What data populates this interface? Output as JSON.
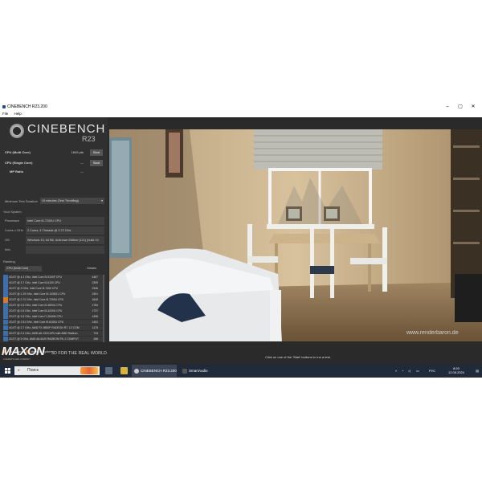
{
  "window": {
    "title": "CINEBENCH R23.200",
    "controls": [
      "–",
      "▢",
      "✕"
    ],
    "menu": [
      "File",
      "Help"
    ]
  },
  "logo": {
    "name": "CINEBENCH",
    "version": "R23"
  },
  "tests": [
    {
      "label": "CPU (Multi Core)",
      "value": "1645 pts",
      "button": "Start"
    },
    {
      "label": "CPU (Single Core)",
      "value": "---",
      "button": "Start"
    },
    {
      "label": "MP Ratio",
      "value": "---"
    }
  ],
  "duration": {
    "label": "Minimum Test Duration",
    "value": "10 minutes (Test Throttling)"
  },
  "system": {
    "title": "Your System",
    "fields": [
      {
        "label": "Processor",
        "value": "Intel Core i5-7200U CPU"
      },
      {
        "label": "Cores x GHz",
        "value": "2 Cores, 4 Threads @ 2.72 GHz"
      },
      {
        "label": "OS",
        "value": "Windows 10, 64 Bit, Unknown Edition (121) (build 19"
      },
      {
        "label": "Info",
        "value": ""
      }
    ]
  },
  "ranking": {
    "title": "Ranking",
    "select": "CPU (Multi Core)",
    "details": "Details",
    "rows": [
      {
        "text": "4C/4T @ 4.1 GHz, Intel Core i5-9100F CPU",
        "score": "4467"
      },
      {
        "text": "4C/4T @ 3.7 GHz, Intel Core i5-6100 CPU",
        "score": "2399"
      },
      {
        "text": "4C/4T @ 3 GHz, Intel Core i5-7400 CPU",
        "score": "2346"
      },
      {
        "text": "2C/4T @ 1.19 GHz, Intel Core i5-1035G1 CPU",
        "score": "2301"
      },
      {
        "text": "2C/4T @ 2.72 GHz, Intel Core i5-7200U CPU",
        "score": "1645",
        "you": true
      },
      {
        "text": "2C/4T @ 2.6 GHz, Intel Core i5-3500U CPU",
        "score": "1784"
      },
      {
        "text": "2C/4T @ 2.6 GHz, Intel Core i5-4200U CPU",
        "score": "1737"
      },
      {
        "text": "2C/4T @ 2.6 GHz, Intel Core i7-2640M CPU",
        "score": "1496"
      },
      {
        "text": "2C/4T @ 2.51 GHz, Intel Core i5-6150U CPU",
        "score": "1451"
      },
      {
        "text": "4C/4T @ 2.7 GHz, AMD FX-9800P RADEON R7, 12 COM",
        "score": "1175"
      },
      {
        "text": "4C/4T @ 2.4 GHz, AMD A6-1310 APU with AMD Radeon",
        "score": "743"
      },
      {
        "text": "2C/2T @ 3 GHz, AMD A6-9420 RADEON R5, 2 COMPUT",
        "score": "288"
      }
    ]
  },
  "legend": {
    "your_score": "Your Score",
    "identical": "Identical System"
  },
  "brand": {
    "logo": "MAXON",
    "sub": "A NEMETSCHEK COMPANY",
    "tagline": "3D FOR THE REAL WORLD"
  },
  "render": {
    "watermark": "www.renderbaron.de"
  },
  "status": {
    "message": "Click on one of the 'Start' buttons to run a test."
  },
  "taskbar": {
    "search": "Поиск",
    "apps": [
      {
        "label": "CINEBENCH R23.200",
        "active": true
      },
      {
        "label": "SmartAudio",
        "active": false
      }
    ],
    "lang": "РУС",
    "time": "8:20",
    "date": "12.05.2024"
  },
  "colors": {
    "accent_blue": "#3f6fa8",
    "your_score": "#d77a27",
    "identical": "#a05a22"
  }
}
